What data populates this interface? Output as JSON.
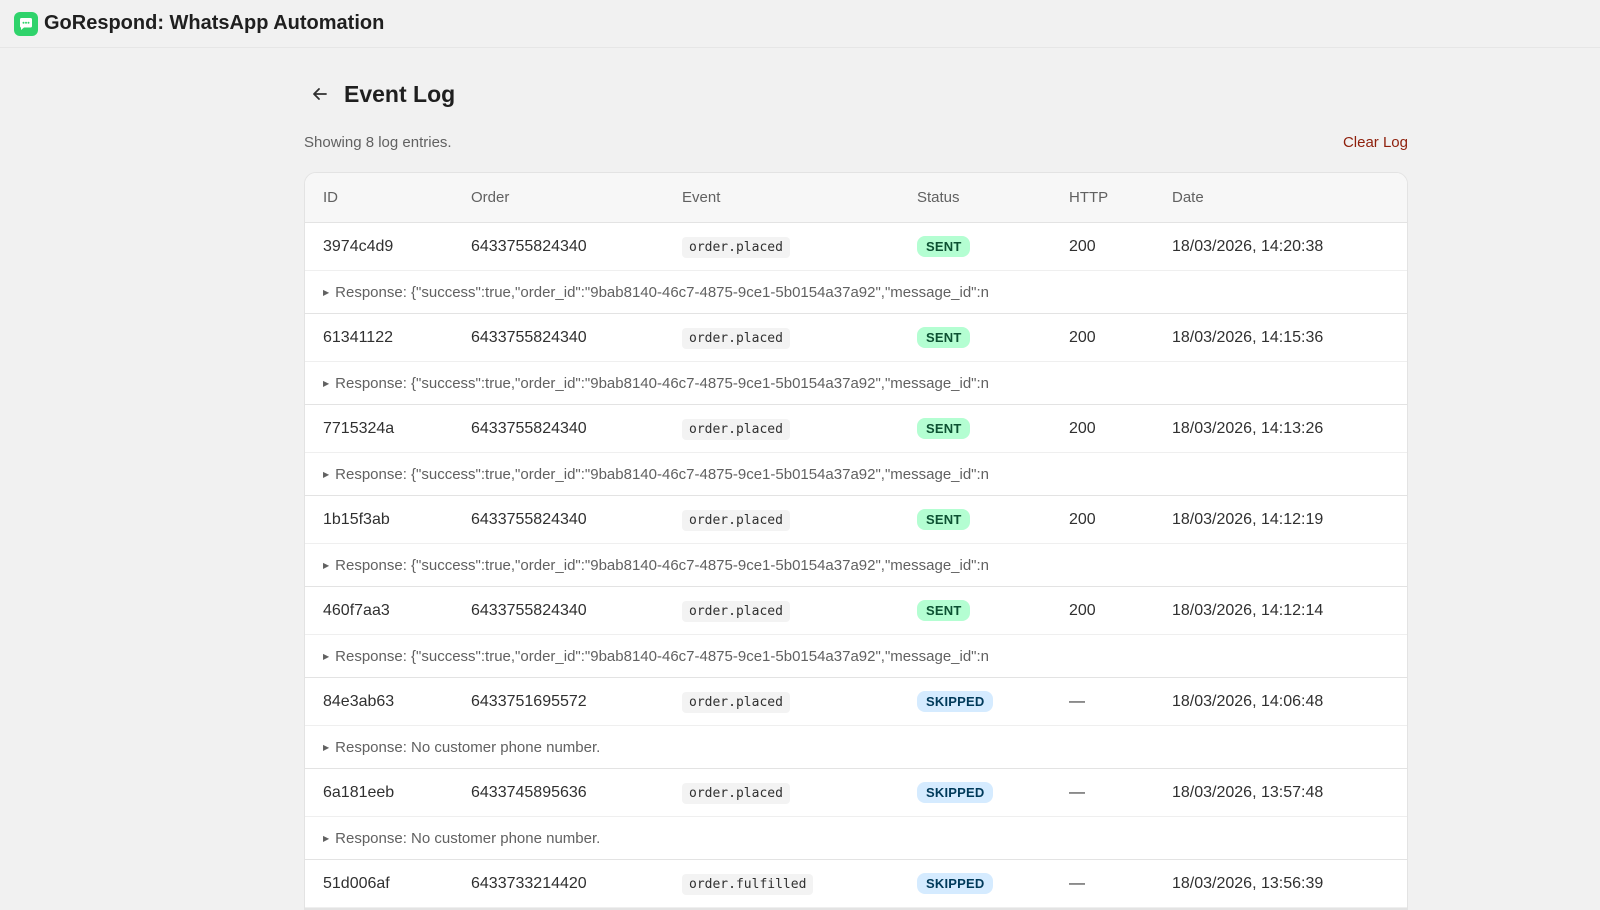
{
  "app": {
    "title": "GoRespond: WhatsApp Automation",
    "icon": "chat-bubble-icon",
    "accent": "#2fd36b"
  },
  "page": {
    "title": "Event Log",
    "back_icon": "arrow-left-icon"
  },
  "summary": "Showing 8 log entries.",
  "clear_label": "Clear Log",
  "table": {
    "columns": [
      "ID",
      "Order",
      "Event",
      "Status",
      "HTTP",
      "Date"
    ],
    "rows": [
      {
        "id": "3974c4d9",
        "order": "6433755824340",
        "event": "order.placed",
        "status": "SENT",
        "http": "200",
        "date": "18/03/2026, 14:20:38",
        "response": "Response: {\"success\":true,\"order_id\":\"9bab8140-46c7-4875-9ce1-5b0154a37a92\",\"message_id\":n"
      },
      {
        "id": "61341122",
        "order": "6433755824340",
        "event": "order.placed",
        "status": "SENT",
        "http": "200",
        "date": "18/03/2026, 14:15:36",
        "response": "Response: {\"success\":true,\"order_id\":\"9bab8140-46c7-4875-9ce1-5b0154a37a92\",\"message_id\":n"
      },
      {
        "id": "7715324a",
        "order": "6433755824340",
        "event": "order.placed",
        "status": "SENT",
        "http": "200",
        "date": "18/03/2026, 14:13:26",
        "response": "Response: {\"success\":true,\"order_id\":\"9bab8140-46c7-4875-9ce1-5b0154a37a92\",\"message_id\":n"
      },
      {
        "id": "1b15f3ab",
        "order": "6433755824340",
        "event": "order.placed",
        "status": "SENT",
        "http": "200",
        "date": "18/03/2026, 14:12:19",
        "response": "Response: {\"success\":true,\"order_id\":\"9bab8140-46c7-4875-9ce1-5b0154a37a92\",\"message_id\":n"
      },
      {
        "id": "460f7aa3",
        "order": "6433755824340",
        "event": "order.placed",
        "status": "SENT",
        "http": "200",
        "date": "18/03/2026, 14:12:14",
        "response": "Response: {\"success\":true,\"order_id\":\"9bab8140-46c7-4875-9ce1-5b0154a37a92\",\"message_id\":n"
      },
      {
        "id": "84e3ab63",
        "order": "6433751695572",
        "event": "order.placed",
        "status": "SKIPPED",
        "http": "—",
        "date": "18/03/2026, 14:06:48",
        "response": "Response: No customer phone number."
      },
      {
        "id": "6a181eeb",
        "order": "6433745895636",
        "event": "order.placed",
        "status": "SKIPPED",
        "http": "—",
        "date": "18/03/2026, 13:57:48",
        "response": "Response: No customer phone number."
      },
      {
        "id": "51d006af",
        "order": "6433733214420",
        "event": "order.fulfilled",
        "status": "SKIPPED",
        "http": "—",
        "date": "18/03/2026, 13:56:39",
        "response": ""
      }
    ]
  }
}
